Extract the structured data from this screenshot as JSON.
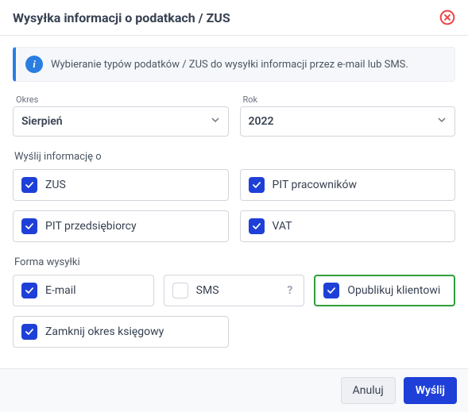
{
  "header": {
    "title": "Wysyłka informacji o podatkach / ZUS"
  },
  "info": {
    "text": "Wybieranie typów podatków / ZUS do wysyłki informacji przez e-mail lub SMS."
  },
  "period": {
    "label": "Okres",
    "value": "Sierpień"
  },
  "year": {
    "label": "Rok",
    "value": "2022"
  },
  "sections": {
    "info_about": "Wyślij informację o",
    "delivery": "Forma wysyłki"
  },
  "taxes": {
    "zus": "ZUS",
    "pit_emp": "PIT pracowników",
    "pit_ent": "PIT przedsiębiorcy",
    "vat": "VAT"
  },
  "delivery": {
    "email": "E-mail",
    "sms": "SMS",
    "publish": "Opublikuj klientowi"
  },
  "close_period": "Zamknij okres księgowy",
  "footer": {
    "cancel": "Anuluj",
    "send": "Wyślij"
  }
}
